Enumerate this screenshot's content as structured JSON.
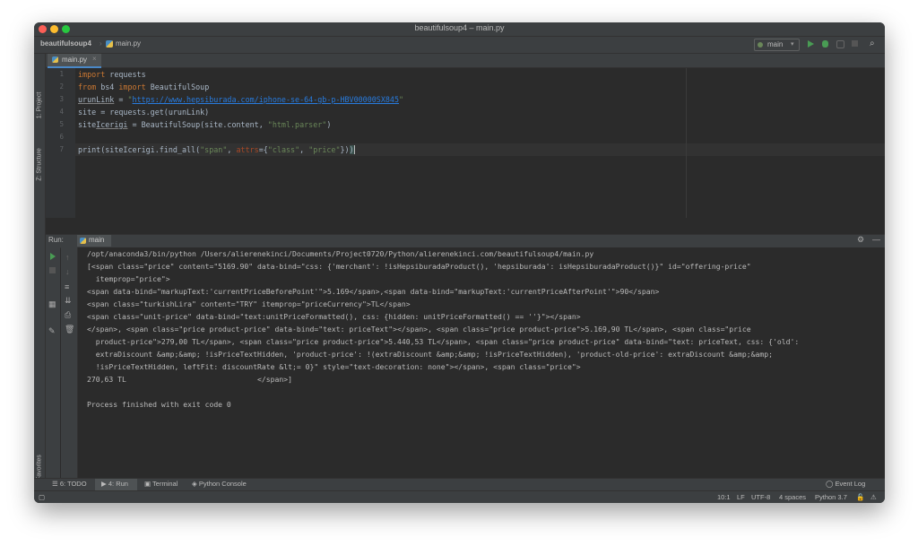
{
  "window": {
    "title": "beautifulsoup4 – main.py"
  },
  "navbar": {
    "project": "beautifulsoup4",
    "file": "main.py",
    "run_config": "main"
  },
  "left_strip": {
    "project_tab": "1: Project",
    "structure_tab": "Z: Structure",
    "favorites_tab": "2: Favorites"
  },
  "editor": {
    "tab_label": "main.py",
    "line_numbers": [
      "1",
      "2",
      "3",
      "4",
      "5",
      "6",
      "7"
    ],
    "code": {
      "l1_kw": "import",
      "l1_rest": " requests",
      "l2_kw1": "from",
      "l2_mid": " bs4 ",
      "l2_kw2": "import",
      "l2_rest": " BeautifulSoup",
      "l3_var": "urunLink",
      "l3_eq": " = ",
      "l3_q1": "\"",
      "l3_url": "https://www.hepsiburada.com/iphone-se-64-gb-p-HBV00000SX845",
      "l3_q2": "\"",
      "l4_text": "site = requests.get(urunLink)",
      "l5_a": "site",
      "l5_b": "Icerigi",
      "l5_c": " = BeautifulSoup(site.content, ",
      "l5_str": "\"html.parser\"",
      "l5_end": ")",
      "l7_a": "print(siteIcerigi.find_all(",
      "l7_s1": "\"span\"",
      "l7_c": ", ",
      "l7_param": "attrs",
      "l7_d": "={",
      "l7_s2": "\"class\"",
      "l7_e": ", ",
      "l7_s3": "\"price\"",
      "l7_f": "}",
      "l7_g": ")",
      "l7_h": ")"
    }
  },
  "run_panel": {
    "title": "Run:",
    "tab": "main",
    "console_lines": [
      "/opt/anaconda3/bin/python /Users/alierenekinci/Documents/Project0720/Python/alierenekinci.com/beautifulsoup4/main.py",
      "[<span class=\"price\" content=\"5169.90\" data-bind=\"css: {'merchant': !isHepsiburadaProduct(), 'hepsiburada': isHepsiburadaProduct()}\" id=\"offering-price\"",
      "  itemprop=\"price\">",
      "<span data-bind=\"markupText:'currentPriceBeforePoint'\">5.169</span>,<span data-bind=\"markupText:'currentPriceAfterPoint'\">90</span>",
      "<span class=\"turkishLira\" content=\"TRY\" itemprop=\"priceCurrency\">TL</span>",
      "<span class=\"unit-price\" data-bind=\"text:unitPriceFormatted(), css: {hidden: unitPriceFormatted() == ''}\"></span>",
      "</span>, <span class=\"price product-price\" data-bind=\"text: priceText\"></span>, <span class=\"price product-price\">5.169,90 TL</span>, <span class=\"price",
      "  product-price\">279,00 TL</span>, <span class=\"price product-price\">5.440,53 TL</span>, <span class=\"price product-price\" data-bind=\"text: priceText, css: {'old':",
      "  extraDiscount &amp;&amp; !isPriceTextHidden, 'product-price': !(extraDiscount &amp;&amp; !isPriceTextHidden), 'product-old-price': extraDiscount &amp;&amp;",
      "  !isPriceTextHidden, leftFit: discountRate &lt;= 0}\" style=\"text-decoration: none\"></span>, <span class=\"price\">",
      "270,63 TL                              </span>]",
      "",
      "Process finished with exit code 0"
    ]
  },
  "bottom_tabs": {
    "todo": "6: TODO",
    "run": "4: Run",
    "terminal": "Terminal",
    "python_console": "Python Console",
    "event_log": "Event Log"
  },
  "status_bar": {
    "position": "10:1",
    "line_ending": "LF",
    "encoding": "UTF-8",
    "indent": "4 spaces",
    "interpreter": "Python 3.7"
  },
  "colors": {
    "editor_bg": "#2b2b2b",
    "panel_bg": "#3c3f41",
    "keyword": "#cc7832",
    "string": "#6a8759",
    "link": "#287bde",
    "run_green": "#499c54"
  }
}
